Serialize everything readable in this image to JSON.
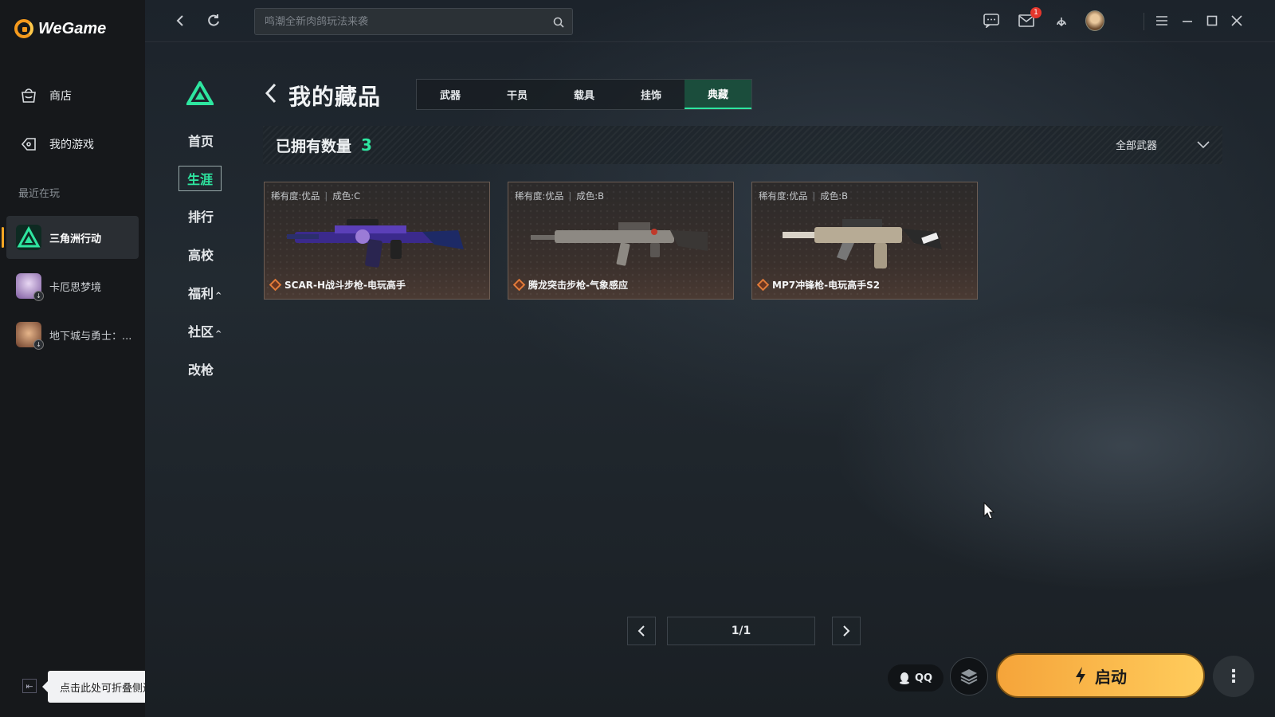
{
  "app": {
    "name": "WeGame"
  },
  "sidebar": {
    "nav": [
      {
        "label": "商店",
        "icon": "store-bag-icon"
      },
      {
        "label": "我的游戏",
        "icon": "my-games-icon"
      }
    ],
    "recent_label": "最近在玩",
    "recent_games": [
      {
        "name": "三角洲行动",
        "active": true
      },
      {
        "name": "卡厄思梦境",
        "active": false
      },
      {
        "name": "地下城与勇士：...",
        "active": false
      }
    ],
    "collapse_tooltip": "点击此处可折叠侧边栏"
  },
  "topbar": {
    "search_placeholder": "鸣潮全新肉鸽玩法来袭",
    "mail_badge": "1"
  },
  "game_nav": {
    "items": [
      {
        "label": "首页",
        "active": false
      },
      {
        "label": "生涯",
        "active": true
      },
      {
        "label": "排行",
        "active": false
      },
      {
        "label": "高校",
        "active": false
      },
      {
        "label": "福利",
        "active": false
      },
      {
        "label": "社区",
        "active": false
      },
      {
        "label": "改枪",
        "active": false
      }
    ]
  },
  "collection": {
    "title": "我的藏品",
    "tabs": [
      {
        "label": "武器",
        "active": false
      },
      {
        "label": "干员",
        "active": false
      },
      {
        "label": "载具",
        "active": false
      },
      {
        "label": "挂饰",
        "active": false
      },
      {
        "label": "典藏",
        "active": true
      }
    ],
    "owned_label": "已拥有数量",
    "owned_count": "3",
    "filter_label": "全部武器",
    "items": [
      {
        "rarity": "稀有度:优品",
        "grade": "成色:C",
        "name": "SCAR-H战斗步枪-电玩高手"
      },
      {
        "rarity": "稀有度:优品",
        "grade": "成色:B",
        "name": "腾龙突击步枪-气象感应"
      },
      {
        "rarity": "稀有度:优品",
        "grade": "成色:B",
        "name": "MP7冲锋枪-电玩高手S2"
      }
    ],
    "pagination": "1/1"
  },
  "launch": {
    "qq_label": "QQ",
    "start_label": "启动"
  },
  "colors": {
    "accent_green": "#2ee6a0",
    "launch_orange": "#f5a43a",
    "badge_red": "#e5372d"
  }
}
